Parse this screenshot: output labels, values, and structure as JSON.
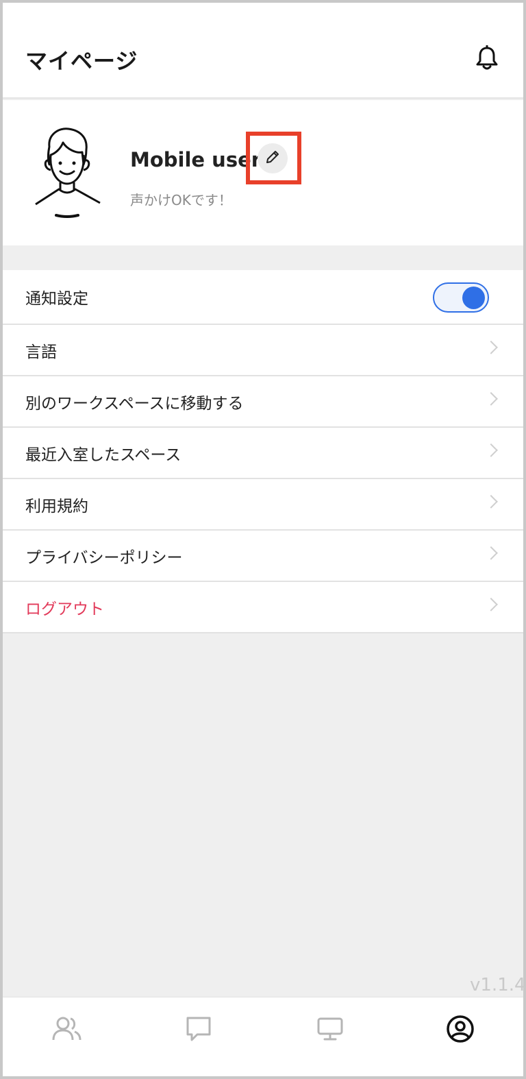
{
  "header": {
    "title": "マイページ",
    "bell_icon": "bell-icon"
  },
  "profile": {
    "name": "Mobile user",
    "status": "声かけOKです！",
    "avatar_icon": "avatar-illustration",
    "edit_icon": "pencil-icon",
    "highlight_color": "#e8402a"
  },
  "menu": {
    "notification": {
      "label": "通知設定",
      "enabled": true
    },
    "items": [
      {
        "label": "言語"
      },
      {
        "label": "別のワークスペースに移動する"
      },
      {
        "label": "最近入室したスペース"
      },
      {
        "label": "利用規約"
      },
      {
        "label": "プライバシーポリシー"
      },
      {
        "label": "ログアウト"
      }
    ]
  },
  "version": "v1.1.4",
  "tabbar": {
    "tabs": [
      {
        "icon": "users-icon",
        "active": false
      },
      {
        "icon": "chat-icon",
        "active": false
      },
      {
        "icon": "monitor-icon",
        "active": false
      },
      {
        "icon": "account-icon",
        "active": true
      }
    ]
  },
  "colors": {
    "accent": "#2f6fe6",
    "danger": "#e23a5a"
  }
}
